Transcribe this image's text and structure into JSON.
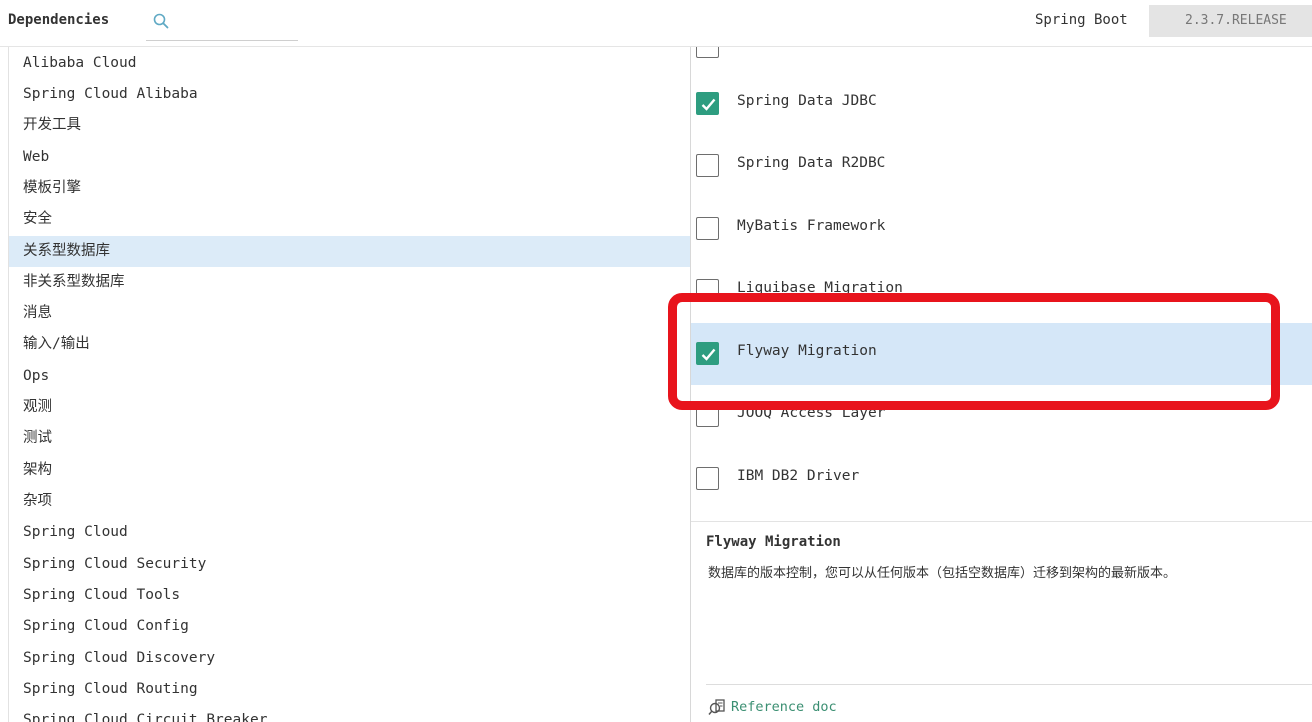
{
  "header": {
    "dependencies_label": "Dependencies",
    "search_placeholder": "",
    "spring_boot_label": "Spring Boot",
    "spring_boot_version": "2.3.7.RELEASE"
  },
  "categories": [
    "Alibaba Cloud",
    "Spring Cloud Alibaba",
    "开发工具",
    "Web",
    "模板引擎",
    "安全",
    "关系型数据库",
    "非关系型数据库",
    "消息",
    "输入/输出",
    "Ops",
    "观测",
    "测试",
    "架构",
    "杂项",
    "Spring Cloud",
    "Spring Cloud Security",
    "Spring Cloud Tools",
    "Spring Cloud Config",
    "Spring Cloud Discovery",
    "Spring Cloud Routing",
    "Spring Cloud Circuit Breaker"
  ],
  "selected_category": "关系型数据库",
  "dependencies": [
    {
      "label": "Spring Data JDBC",
      "checked": true
    },
    {
      "label": "Spring Data R2DBC",
      "checked": false
    },
    {
      "label": "MyBatis Framework",
      "checked": false
    },
    {
      "label": "Liquibase Migration",
      "checked": false
    },
    {
      "label": "Flyway Migration",
      "checked": true,
      "highlighted": true
    },
    {
      "label": "JOOQ Access Layer",
      "checked": false
    },
    {
      "label": "IBM DB2 Driver",
      "checked": false
    }
  ],
  "description": {
    "title": "Flyway Migration",
    "text": "数据库的版本控制，您可以从任何版本（包括空数据库）迁移到架构的最新版本。",
    "reference_label": "Reference doc"
  },
  "colors": {
    "checkbox_checked": "#2e9d80",
    "selection_bg": "#dcebf8",
    "link": "#3b8f72",
    "annotation": "#e8141c"
  },
  "icons": {
    "search": "search-icon",
    "checkmark": "check-icon",
    "reference": "document-link-icon"
  }
}
